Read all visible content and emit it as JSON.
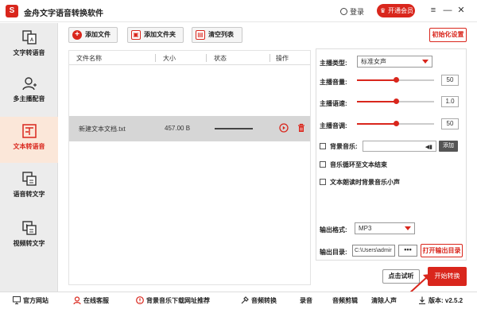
{
  "app": {
    "logo_glyph": "S",
    "title": "金舟文字语音转换软件",
    "login": "登录",
    "vip": "开通会员",
    "min_glyph": "—",
    "max_glyph": "☐",
    "close_glyph": "✕",
    "brand_color": "#d9261c"
  },
  "sidebar": {
    "items": [
      {
        "label": "文字转语音",
        "icon": "text-to-speech-icon"
      },
      {
        "label": "多主播配音",
        "icon": "multi-voice-icon"
      },
      {
        "label": "文本转语音",
        "icon": "document-to-speech-icon"
      },
      {
        "label": "语音转文字",
        "icon": "speech-to-text-icon"
      },
      {
        "label": "视频转文字",
        "icon": "video-to-text-icon"
      }
    ],
    "active_index": 2
  },
  "toolbar": {
    "add_file": "添加文件",
    "add_folder": "添加文件夹",
    "clear_list": "清空列表",
    "init_settings": "初始化设置"
  },
  "file_list": {
    "columns": [
      "文件名称",
      "大小",
      "状态",
      "操作"
    ],
    "rows": [
      {
        "name": "新建文本文档.txt",
        "size": "457.00 B"
      }
    ]
  },
  "settings": {
    "voice_type_label": "主播类型:",
    "voice_type_value": "标准女声",
    "volume_label": "主播音量:",
    "volume_value": "50",
    "volume_fraction": 0.5,
    "speed_label": "主播语速:",
    "speed_value": "1.0",
    "speed_fraction": 0.5,
    "pitch_label": "主播音调:",
    "pitch_value": "50",
    "pitch_fraction": 0.5,
    "bgm_label": "背景音乐:",
    "bgm_button": "添加",
    "loop_label": "音乐循环至文本结束",
    "lower_bgm_label": "文本朗读时背景音乐小声",
    "output_format_label": "输出格式:",
    "output_format_value": "MP3",
    "output_dir_label": "输出目录:",
    "output_dir_value": "C:\\Users\\admir",
    "browse_glyph": "•••",
    "open_output": "打开输出目录"
  },
  "actions": {
    "trial": "点击试听",
    "start": "开始转换"
  },
  "footer": {
    "website": "官方网站",
    "support": "在线客服",
    "bgm_site": "背景音乐下载网址推荐",
    "audio_convert": "音频转换",
    "record": "录音",
    "audio_cut": "音频剪辑",
    "clean_voice": "清除人声",
    "version": "版本: v2.5.2"
  }
}
